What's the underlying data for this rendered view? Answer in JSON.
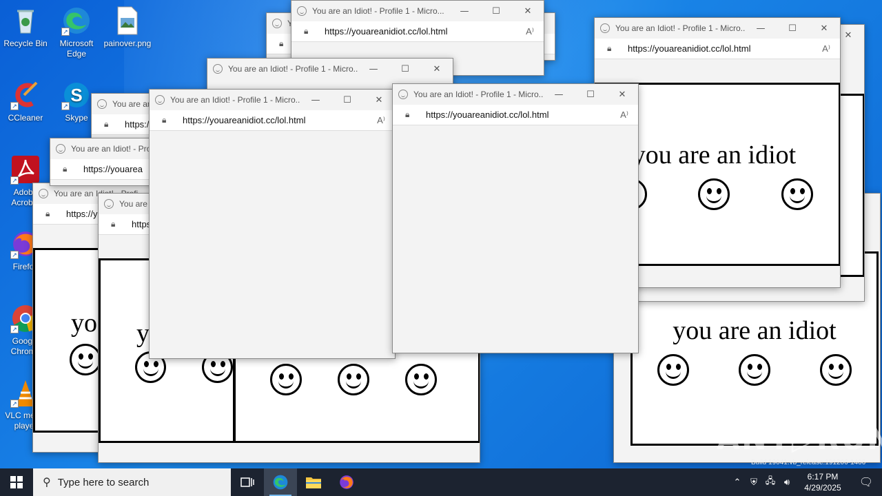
{
  "desktop": {
    "icons": [
      {
        "label": "Recycle Bin"
      },
      {
        "label": "Microsoft Edge"
      },
      {
        "label": "painover.png"
      },
      {
        "label": "CCleaner"
      },
      {
        "label": "Skype"
      },
      {
        "label": "Adobe Acrobat"
      },
      {
        "label": "Firefox"
      },
      {
        "label": "Google Chrome"
      },
      {
        "label": "VLC media player"
      }
    ]
  },
  "window": {
    "title": "You are an Idiot! - Profile 1 - Micro...",
    "title_short": "You are an Idiot! - Profi",
    "url": "https://youareanidiot.cc/lol.html",
    "url_short": "https://youarea",
    "controls": {
      "minimize": "—",
      "maximize": "☐",
      "close": "✕"
    },
    "read_aloud": "A⁾"
  },
  "page": {
    "message": "you are an idiot",
    "message_cut_1": "yo",
    "message_cut_2": "y"
  },
  "taskbar": {
    "search_placeholder": "Type here to search",
    "time": "6:17 PM",
    "date": "4/29/2025"
  },
  "overlay": {
    "watermark": "ANY▷RUN",
    "build_text": "Build 19041.vb_release.191206-1406"
  }
}
